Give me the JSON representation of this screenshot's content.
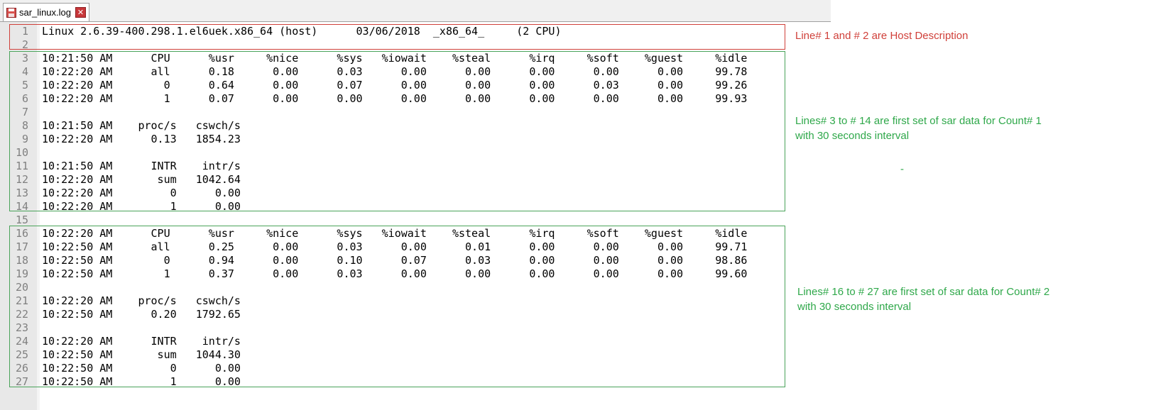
{
  "tab": {
    "title": "sar_linux.log",
    "close": "✕"
  },
  "lines": [
    {
      "n": "1",
      "t": "Linux 2.6.39-400.298.1.el6uek.x86_64 (host)      03/06/2018  _x86_64_     (2 CPU)"
    },
    {
      "n": "2",
      "t": ""
    },
    {
      "n": "3",
      "t": "10:21:50 AM      CPU      %usr     %nice      %sys   %iowait    %steal      %irq     %soft    %guest     %idle"
    },
    {
      "n": "4",
      "t": "10:22:20 AM      all      0.18      0.00      0.03      0.00      0.00      0.00      0.00      0.00     99.78"
    },
    {
      "n": "5",
      "t": "10:22:20 AM        0      0.64      0.00      0.07      0.00      0.00      0.00      0.03      0.00     99.26"
    },
    {
      "n": "6",
      "t": "10:22:20 AM        1      0.07      0.00      0.00      0.00      0.00      0.00      0.00      0.00     99.93"
    },
    {
      "n": "7",
      "t": ""
    },
    {
      "n": "8",
      "t": "10:21:50 AM    proc/s   cswch/s"
    },
    {
      "n": "9",
      "t": "10:22:20 AM      0.13   1854.23"
    },
    {
      "n": "10",
      "t": ""
    },
    {
      "n": "11",
      "t": "10:21:50 AM      INTR    intr/s"
    },
    {
      "n": "12",
      "t": "10:22:20 AM       sum   1042.64"
    },
    {
      "n": "13",
      "t": "10:22:20 AM         0      0.00"
    },
    {
      "n": "14",
      "t": "10:22:20 AM         1      0.00"
    },
    {
      "n": "15",
      "t": ""
    },
    {
      "n": "16",
      "t": "10:22:20 AM      CPU      %usr     %nice      %sys   %iowait    %steal      %irq     %soft    %guest     %idle"
    },
    {
      "n": "17",
      "t": "10:22:50 AM      all      0.25      0.00      0.03      0.00      0.01      0.00      0.00      0.00     99.71"
    },
    {
      "n": "18",
      "t": "10:22:50 AM        0      0.94      0.00      0.10      0.07      0.03      0.00      0.00      0.00     98.86"
    },
    {
      "n": "19",
      "t": "10:22:50 AM        1      0.37      0.00      0.03      0.00      0.00      0.00      0.00      0.00     99.60"
    },
    {
      "n": "20",
      "t": ""
    },
    {
      "n": "21",
      "t": "10:22:20 AM    proc/s   cswch/s"
    },
    {
      "n": "22",
      "t": "10:22:50 AM      0.20   1792.65"
    },
    {
      "n": "23",
      "t": ""
    },
    {
      "n": "24",
      "t": "10:22:20 AM      INTR    intr/s"
    },
    {
      "n": "25",
      "t": "10:22:50 AM       sum   1044.30"
    },
    {
      "n": "26",
      "t": "10:22:50 AM         0      0.00"
    },
    {
      "n": "27",
      "t": "10:22:50 AM         1      0.00"
    }
  ],
  "annotations": {
    "host": "Line# 1 and # 2 are Host Description",
    "count1_a": "Lines# 3 to # 14 are first set of sar data for Count# 1",
    "count1_b": "with 30 seconds interval",
    "dash": "-",
    "count2_a": "Lines# 16 to # 27 are first set of sar data for Count# 2",
    "count2_b": "with 30 seconds interval"
  },
  "colors": {
    "red": "#d0403a",
    "green": "#2fa84a"
  }
}
